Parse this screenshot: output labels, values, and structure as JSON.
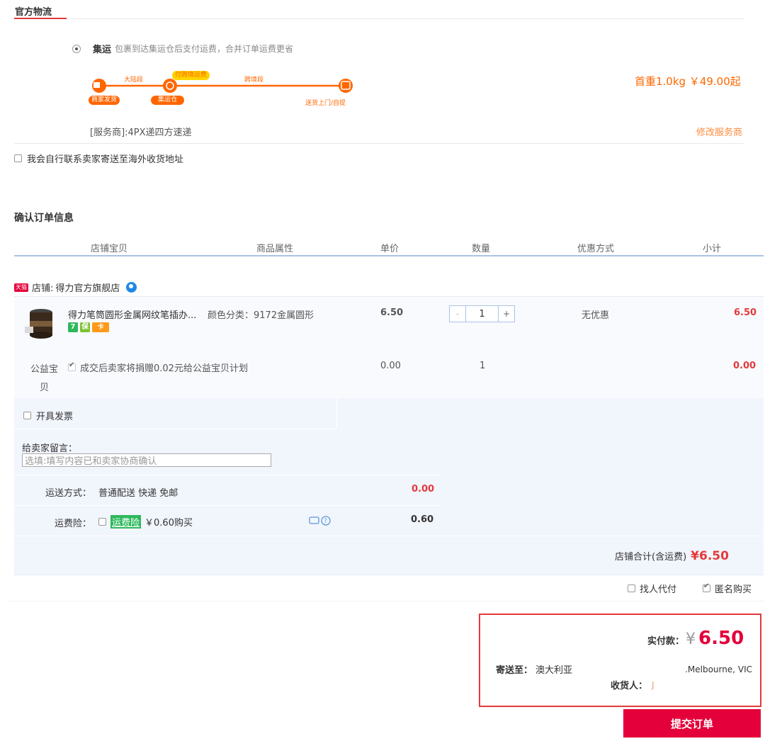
{
  "logistics": {
    "section_title": "官方物流",
    "option_name": "集运",
    "option_desc": "包裹到达集运仓后支付运费，合并订单运费更省",
    "route": {
      "leg1": "大陆段",
      "leg2": "跨境段",
      "pay_badge": "付跨境运费",
      "node1": "商家发货",
      "node2": "集运仓",
      "node3": "送货上门/自提"
    },
    "price_text": "首重1.0kg ￥49.00起",
    "provider": "[服务商]:4PX递四方速递",
    "change_provider": "修改服务商",
    "self_contact": "我会自行联系卖家寄送至海外收货地址"
  },
  "order": {
    "section_title": "确认订单信息",
    "columns": [
      "店铺宝贝",
      "商品属性",
      "单价",
      "数量",
      "优惠方式",
      "小计"
    ],
    "shop_badge": "天猫",
    "shop_label": "店铺:",
    "shop_name": "得力官方旗舰店",
    "item": {
      "title": "得力笔筒圆形金属网纹笔插办...",
      "attr": "颜色分类：9172金属圆形",
      "price": "6.50",
      "qty": "1",
      "minus": "-",
      "plus": "+",
      "discount": "无优惠",
      "subtotal": "6.50",
      "tags": [
        "7",
        "保",
        "卡"
      ]
    },
    "charity": {
      "label_line1": "公益宝",
      "label_line2": "贝",
      "desc": "成交后卖家将捐赠0.02元给公益宝贝计划",
      "price": "0.00",
      "qty": "1",
      "subtotal": "0.00"
    },
    "invoice": "开具发票",
    "message_label": "给卖家留言：",
    "message_placeholder": "选填:填写内容已和卖家协商确认",
    "shipping_label": "运送方式：",
    "shipping_value": "普通配送 快递 免邮",
    "shipping_price": "0.00",
    "insurance_label": "运费险：",
    "insurance_name": "运费险",
    "insurance_price_text": "￥0.60购买",
    "insurance_price": "0.60",
    "shop_total_label": "店铺合计(含运费)",
    "shop_total": "¥6.50",
    "pay_for_me": "找人代付",
    "anonymous": "匿名购买"
  },
  "summary": {
    "paid_label": "实付款：",
    "currency": "¥",
    "paid_amount": "6.50",
    "ship_to_label": "寄送至：",
    "ship_to_country": "澳大利亚",
    "ship_to_city": ".Melbourne, VIC",
    "receiver_label": "收货人：",
    "receiver_value": "J",
    "submit": "提交订单"
  },
  "colors": {
    "accent_red": "#e4393c",
    "orange": "#ff6600",
    "submit_red": "#e4003a",
    "table_header_line": "#aac4e8",
    "row_bg": "#f1f5fc"
  }
}
